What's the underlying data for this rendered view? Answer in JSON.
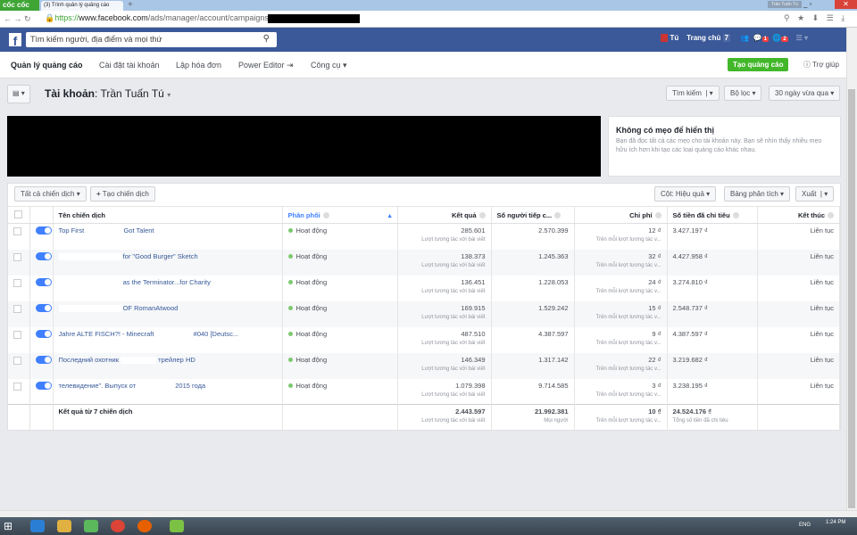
{
  "browser": {
    "brand": "cốc cốc",
    "tab_title": "(3) Trình quản lý quảng cáo",
    "new_tab": "+",
    "user": "Trần Tuấn Tú",
    "url_scheme": "https://",
    "url_host": "www.facebook.com",
    "url_path": "/ads/manager/account/campaigns/?act="
  },
  "fb": {
    "search_placeholder": "Tìm kiếm người, địa điểm và mọi thứ",
    "user_name": "Tú",
    "home": "Trang chủ",
    "home_count": "7",
    "messages_badge": "1",
    "notifications_badge": "2"
  },
  "nav": {
    "items": [
      "Quản lý quảng cáo",
      "Cài đặt tài khoản",
      "Lập hóa đơn",
      "Power Editor",
      "Công cụ"
    ],
    "create_ad": "Tạo quảng cáo",
    "help": "Trợ giúp"
  },
  "account": {
    "label": "Tài khoản",
    "name": "Trần Tuấn Tú",
    "search": "Tìm kiếm",
    "filter": "Bộ lọc",
    "date_range": "30 ngày vừa qua"
  },
  "tip": {
    "title": "Không có mẹo để hiển thị",
    "body": "Bạn đã đọc tất cả các mẹo cho tài khoản này. Bạn sẽ nhìn thấy nhiều mẹo hữu ích hơn khi tạo các loại quảng cáo khác nhau."
  },
  "toolbar": {
    "all_campaigns": "Tất cả chiến dịch",
    "create_campaign": "Tạo chiến dịch",
    "columns": "Cột: Hiệu quả",
    "breakdown": "Bảng phân tích",
    "export": "Xuất"
  },
  "table": {
    "headers": [
      "Tên chiến dịch",
      "Phân phối",
      "Kết quả",
      "Số người tiếp c...",
      "Chi phí",
      "Số tiền đã chi tiêu",
      "Kết thúc"
    ],
    "rows": [
      {
        "name_a": "Top First",
        "name_b": "Got Talent",
        "delivery": "Hoạt động",
        "results": "285.601",
        "results_sub": "Lượt tương tác với bài viết",
        "reach": "2.570.399",
        "cost": "12 ₫",
        "cost_sub": "Trên mỗi lượt tương tác v...",
        "spent": "3.427.197 ₫",
        "end": "Liên tục"
      },
      {
        "name_a": "",
        "name_b": "for \"Good Burger\" Sketch",
        "delivery": "Hoạt động",
        "results": "138.373",
        "results_sub": "Lượt tương tác với bài viết",
        "reach": "1.245.363",
        "cost": "32 ₫",
        "cost_sub": "Trên mỗi lượt tương tác v...",
        "spent": "4.427.958 ₫",
        "end": "Liên tục"
      },
      {
        "name_a": "",
        "name_b": "as the Terminator...for Charity",
        "delivery": "Hoạt động",
        "results": "136.451",
        "results_sub": "Lượt tương tác với bài viết",
        "reach": "1.228.053",
        "cost": "24 ₫",
        "cost_sub": "Trên mỗi lượt tương tác v...",
        "spent": "3.274.810 ₫",
        "end": "Liên tục"
      },
      {
        "name_a": "",
        "name_b": "OF RomanAtwood",
        "delivery": "Hoạt động",
        "results": "169.915",
        "results_sub": "Lượt tương tác với bài viết",
        "reach": "1.529.242",
        "cost": "15 ₫",
        "cost_sub": "Trên mỗi lượt tương tác v...",
        "spent": "2.548.737 ₫",
        "end": "Liên tục"
      },
      {
        "name_a": "Jahre ALTE FISCH?! - Minecraft",
        "name_b": "#040 [Deutsc...",
        "delivery": "Hoạt động",
        "results": "487.510",
        "results_sub": "Lượt tương tác với bài viết",
        "reach": "4.387.597",
        "cost": "9 ₫",
        "cost_sub": "Trên mỗi lượt tương tác v...",
        "spent": "4.387.597 ₫",
        "end": "Liên tục"
      },
      {
        "name_a": "Последний охотник",
        "name_b": "трейлер HD",
        "delivery": "Hoạt động",
        "results": "146.349",
        "results_sub": "Lượt tương tác với bài viết",
        "reach": "1.317.142",
        "cost": "22 ₫",
        "cost_sub": "Trên mỗi lượt tương tác v...",
        "spent": "3.219.682 ₫",
        "end": "Liên tục"
      },
      {
        "name_a": "телевидение\". Выпуск от",
        "name_b": "2015 года",
        "delivery": "Hoạt động",
        "results": "1.079.398",
        "results_sub": "Lượt tương tác với bài viết",
        "reach": "9.714.585",
        "cost": "3 ₫",
        "cost_sub": "Trên mỗi lượt tương tác v...",
        "spent": "3.238.195 ₫",
        "end": "Liên tục"
      }
    ],
    "total": {
      "label": "Kết quả từ 7 chiến dịch",
      "results": "2.443.597",
      "results_sub": "Lượt tương tác với bài viết",
      "reach": "21.992.381",
      "reach_sub": "Mọi người",
      "cost": "10 ₫",
      "cost_sub": "Trên mỗi lượt tương tác v...",
      "spent": "24.524.176 ₫",
      "spent_sub": "Tổng số tiền đã chi tiêu"
    }
  },
  "taskbar": {
    "lang": "ENG",
    "time": "1:24 PM"
  },
  "colors": {
    "fb_blue": "#3b5998",
    "green": "#42b72a",
    "link": "#365899"
  }
}
